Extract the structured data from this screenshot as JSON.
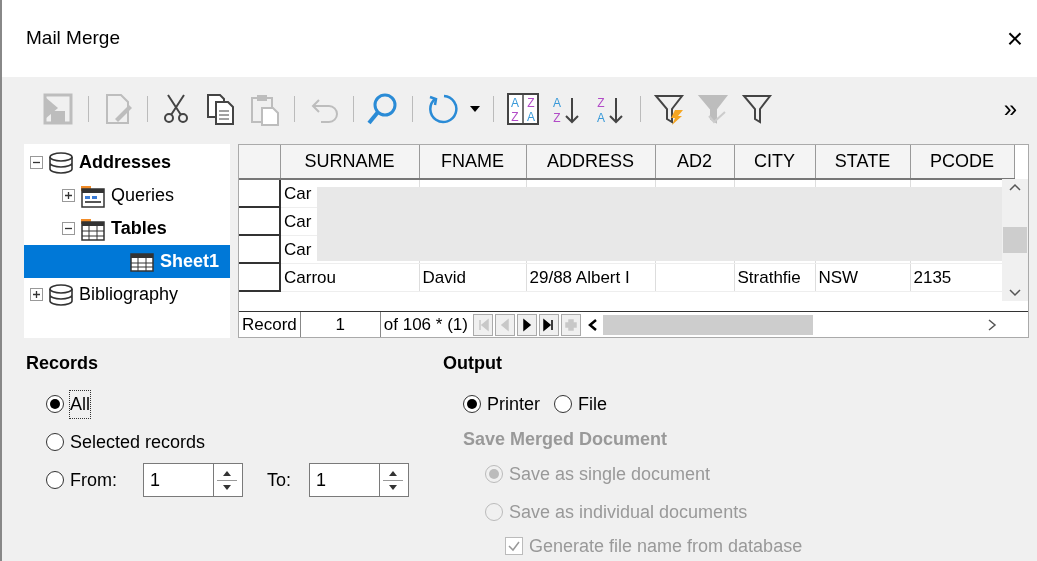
{
  "window": {
    "title": "Mail Merge",
    "close": "×"
  },
  "toolbar": [
    {
      "kind": "save",
      "disabled": true
    },
    {
      "kind": "separator"
    },
    {
      "kind": "edit",
      "disabled": true
    },
    {
      "kind": "separator"
    },
    {
      "kind": "cut",
      "disabled": false
    },
    {
      "kind": "copy",
      "disabled": false
    },
    {
      "kind": "paste",
      "disabled": true
    },
    {
      "kind": "separator"
    },
    {
      "kind": "undo",
      "disabled": true
    },
    {
      "kind": "separator"
    },
    {
      "kind": "search",
      "disabled": false
    },
    {
      "kind": "separator"
    },
    {
      "kind": "refresh",
      "disabled": false
    },
    {
      "kind": "dropdown",
      "disabled": false
    },
    {
      "kind": "separator"
    },
    {
      "kind": "sort",
      "disabled": false,
      "letters": [
        "A",
        "Z",
        "Z",
        "A"
      ]
    },
    {
      "kind": "sort-asc",
      "disabled": false,
      "letters": [
        "A",
        "Z"
      ]
    },
    {
      "kind": "sort-desc",
      "disabled": false,
      "letters": [
        "Z",
        "A"
      ]
    },
    {
      "kind": "separator"
    },
    {
      "kind": "autofilter",
      "disabled": false
    },
    {
      "kind": "apply-filter",
      "disabled": true
    },
    {
      "kind": "filter",
      "disabled": false
    }
  ],
  "toolbar_overflow": "»",
  "tree": [
    {
      "label": "Addresses",
      "kind": "database",
      "bold": true,
      "expanded": true,
      "selected": false,
      "children": [
        {
          "label": "Queries",
          "kind": "queries",
          "bold": false,
          "expanded": false,
          "selected": false
        },
        {
          "label": "Tables",
          "kind": "tables",
          "bold": true,
          "expanded": true,
          "selected": false,
          "children": [
            {
              "label": "Sheet1",
              "kind": "table",
              "bold": true,
              "selected": true
            }
          ]
        }
      ]
    },
    {
      "label": "Bibliography",
      "kind": "database",
      "bold": false,
      "expanded": false,
      "selected": false
    }
  ],
  "table": {
    "columns": [
      "SURNAME",
      "FNAME",
      "ADDRESS",
      "AD2",
      "CITY",
      "STATE",
      "PCODE"
    ],
    "rows": [
      [
        "Car",
        "",
        "",
        "",
        "",
        "",
        ""
      ],
      [
        "Car",
        "",
        "",
        "",
        "",
        "",
        ""
      ],
      [
        "Car",
        "",
        "",
        "",
        "",
        "",
        ""
      ],
      [
        "Carrou",
        "David",
        "29/88 Albert I",
        "",
        "Strathfie",
        "NSW",
        "2135"
      ]
    ],
    "navigation": {
      "label": "Record",
      "current": "1",
      "total": "of 106 * (1)",
      "buttons": [
        {
          "kind": "first",
          "disabled": true
        },
        {
          "kind": "prev",
          "disabled": true
        },
        {
          "kind": "next",
          "disabled": false
        },
        {
          "kind": "last",
          "disabled": false
        },
        {
          "kind": "new",
          "disabled": true
        }
      ]
    }
  },
  "records": {
    "heading": "Records",
    "options": [
      {
        "label": "All",
        "selected": true,
        "focused": true
      },
      {
        "label": "Selected records",
        "selected": false,
        "focused": false
      },
      {
        "label": "From:",
        "selected": false,
        "focused": false
      }
    ],
    "from_value": "1",
    "to_label": "To:",
    "to_value": "1"
  },
  "output": {
    "heading": "Output",
    "options": [
      {
        "label": "Printer",
        "selected": true
      },
      {
        "label": "File",
        "selected": false
      }
    ],
    "save_heading": "Save Merged Document",
    "save_disabled": true,
    "save_options": [
      {
        "label": "Save as single document",
        "selected": true
      },
      {
        "label": "Save as individual documents",
        "selected": false
      }
    ],
    "generate": {
      "label": "Generate file name from database",
      "checked": true
    }
  }
}
